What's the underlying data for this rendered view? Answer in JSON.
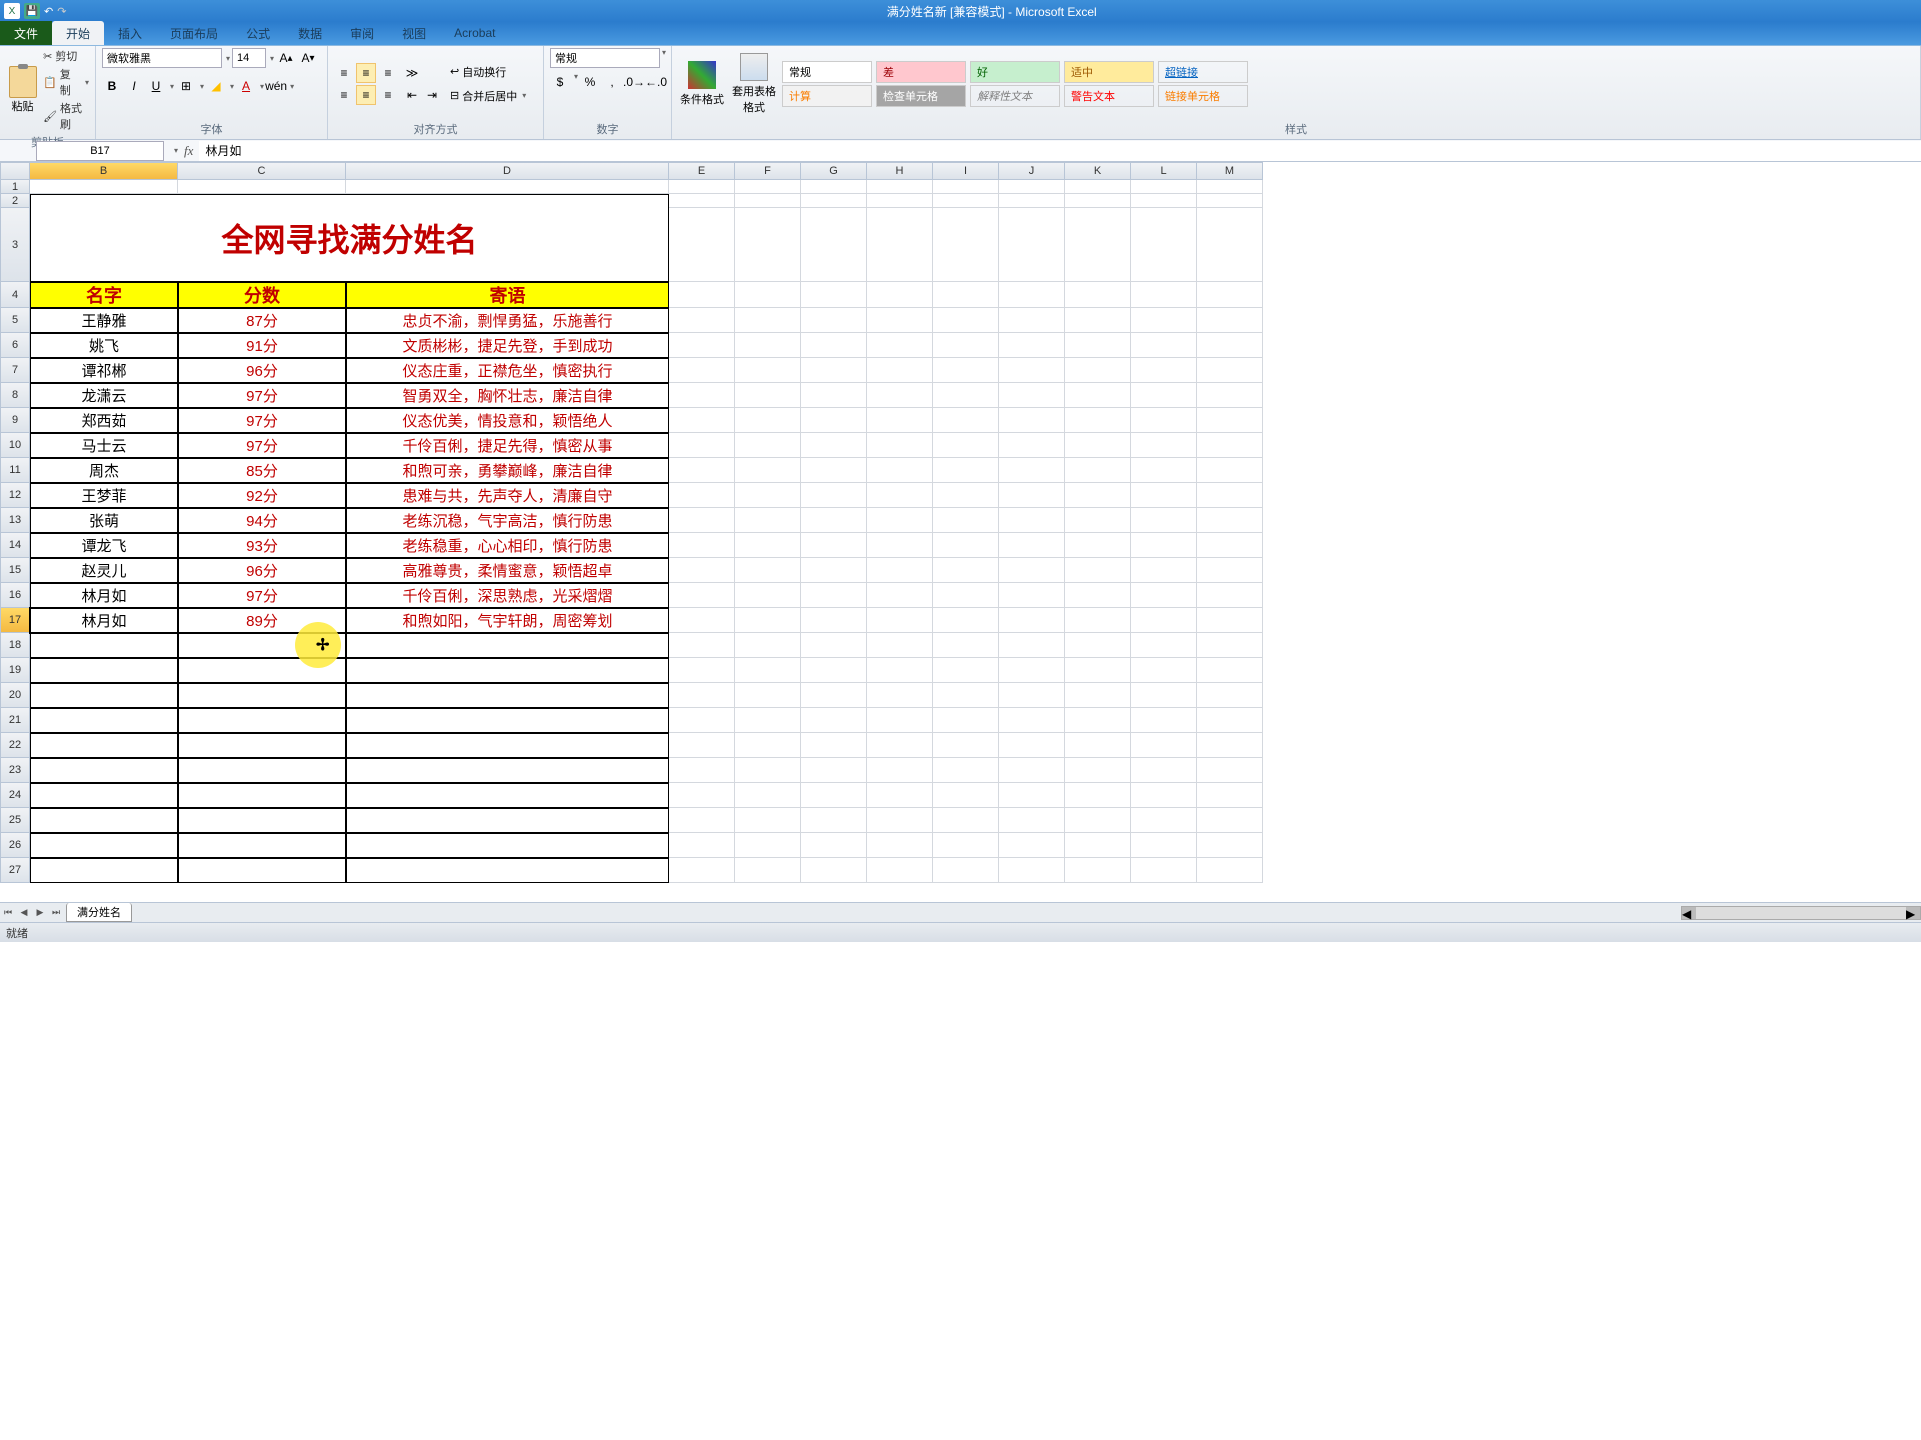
{
  "title": "满分姓名新 [兼容模式] - Microsoft Excel",
  "tabs": {
    "file": "文件",
    "home": "开始",
    "insert": "插入",
    "layout": "页面布局",
    "formulas": "公式",
    "data": "数据",
    "review": "审阅",
    "view": "视图",
    "acrobat": "Acrobat"
  },
  "clipboard": {
    "paste": "粘贴",
    "cut": "剪切",
    "copy": "复制",
    "painter": "格式刷",
    "label": "剪贴板"
  },
  "font": {
    "name": "微软雅黑",
    "size": "14",
    "label": "字体"
  },
  "align": {
    "wrap": "自动换行",
    "merge": "合并后居中",
    "label": "对齐方式"
  },
  "number": {
    "format": "常规",
    "label": "数字"
  },
  "cond": {
    "fmt": "条件格式",
    "table": "套用表格格式"
  },
  "styles": {
    "normal": "常规",
    "bad": "差",
    "good": "好",
    "neutral": "适中",
    "link": "超链接",
    "calc": "计算",
    "check": "检查单元格",
    "explain": "解释性文本",
    "warn": "警告文本",
    "linked": "链接单元格",
    "label": "样式"
  },
  "namebox": "B17",
  "formula": "林月如",
  "sheet_tab": "满分姓名",
  "status": "就绪",
  "columns": [
    "B",
    "C",
    "D",
    "E",
    "F",
    "G",
    "H",
    "I",
    "J",
    "K",
    "L",
    "M"
  ],
  "col_widths": {
    "B": 148,
    "C": 168,
    "D": 323,
    "other": 66
  },
  "table": {
    "title": "全网寻找满分姓名",
    "headers": [
      "名字",
      "分数",
      "寄语"
    ],
    "rows": [
      {
        "name": "王静雅",
        "score": "87分",
        "msg": "忠贞不渝，剽悍勇猛，乐施善行"
      },
      {
        "name": "姚飞",
        "score": "91分",
        "msg": "文质彬彬，捷足先登，手到成功"
      },
      {
        "name": "谭祁郴",
        "score": "96分",
        "msg": "仪态庄重，正襟危坐，慎密执行"
      },
      {
        "name": "龙潇云",
        "score": "97分",
        "msg": "智勇双全，胸怀壮志，廉洁自律"
      },
      {
        "name": "郑西茹",
        "score": "97分",
        "msg": "仪态优美，情投意和，颖悟绝人"
      },
      {
        "name": "马士云",
        "score": "97分",
        "msg": "千伶百俐，捷足先得，慎密从事"
      },
      {
        "name": "周杰",
        "score": "85分",
        "msg": "和煦可亲，勇攀巅峰，廉洁自律"
      },
      {
        "name": "王梦菲",
        "score": "92分",
        "msg": "患难与共，先声夺人，清廉自守"
      },
      {
        "name": "张萌",
        "score": "94分",
        "msg": "老练沉稳，气宇高洁，慎行防患"
      },
      {
        "name": "谭龙飞",
        "score": "93分",
        "msg": "老练稳重，心心相印，慎行防患"
      },
      {
        "name": "赵灵儿",
        "score": "96分",
        "msg": "高雅尊贵，柔情蜜意，颖悟超卓"
      },
      {
        "name": "林月如",
        "score": "97分",
        "msg": "千伶百俐，深思熟虑，光采熠熠"
      },
      {
        "name": "林月如",
        "score": "89分",
        "msg": "和煦如阳，气宇轩朗，周密筹划"
      }
    ]
  },
  "selected_cell": "B17"
}
